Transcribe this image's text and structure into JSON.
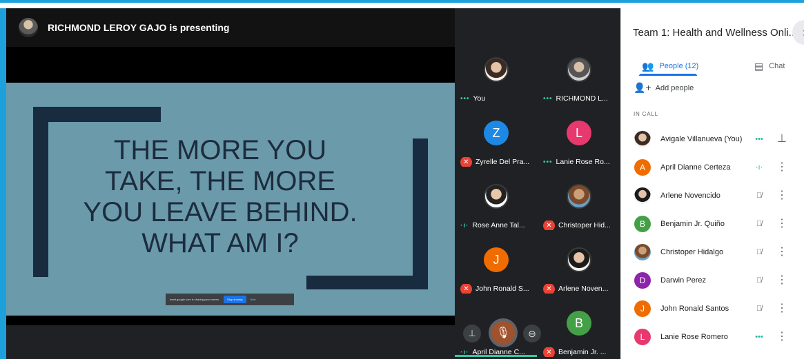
{
  "presenting": {
    "text": "RICHMOND LEROY GAJO is presenting"
  },
  "slide": {
    "lines": [
      "THE MORE YOU",
      "TAKE, THE MORE",
      "YOU LEAVE BEHIND.",
      "WHAT AM I?"
    ]
  },
  "share_bar": {
    "text": "meet.google.com is sharing your screen.",
    "stop_label": "Stop sharing",
    "hide_label": "Hide"
  },
  "tiles": [
    {
      "name": "You",
      "status": "speaking",
      "avatar_letter": "",
      "avatar_color": ""
    },
    {
      "name": "RICHMOND L...",
      "status": "speaking",
      "avatar_letter": "",
      "avatar_color": ""
    },
    {
      "name": "Zyrelle Del Pra...",
      "status": "muted",
      "avatar_letter": "Z",
      "avatar_color": "#1e88e5"
    },
    {
      "name": "Lanie Rose Ro...",
      "status": "speaking",
      "avatar_letter": "L",
      "avatar_color": "#e8396f"
    },
    {
      "name": "Rose Anne Tal...",
      "status": "talking",
      "avatar_letter": "",
      "avatar_color": ""
    },
    {
      "name": "Christoper Hid...",
      "status": "muted",
      "avatar_letter": "",
      "avatar_color": ""
    },
    {
      "name": "John Ronald S...",
      "status": "muted",
      "avatar_letter": "J",
      "avatar_color": "#ef6c00"
    },
    {
      "name": "Arlene Noven...",
      "status": "muted",
      "avatar_letter": "",
      "avatar_color": ""
    },
    {
      "name": "April Dianne C...",
      "status": "talking",
      "avatar_letter": "",
      "avatar_color": ""
    },
    {
      "name": "Benjamin Jr. ...",
      "status": "muted",
      "avatar_letter": "B",
      "avatar_color": "#43a047"
    }
  ],
  "controls": {
    "pin_icon": "pin-icon",
    "mic_icon": "mic-icon",
    "remove_icon": "remove-icon"
  },
  "panel": {
    "title": "Team 1: Health and Wellness Onli...",
    "tab_people": "People (12)",
    "tab_chat": "Chat",
    "add_people": "Add people",
    "in_call_label": "IN CALL",
    "participants": [
      {
        "name": "Avigale Villanueva (You)",
        "status": "speaking",
        "avatar_letter": "",
        "avatar_color": ""
      },
      {
        "name": "April Dianne Certeza",
        "status": "talking",
        "avatar_letter": "A",
        "avatar_color": "#ef6c00"
      },
      {
        "name": "Arlene Novencido",
        "status": "muted",
        "avatar_letter": "",
        "avatar_color": ""
      },
      {
        "name": "Benjamin Jr. Quiño",
        "status": "muted",
        "avatar_letter": "B",
        "avatar_color": "#43a047"
      },
      {
        "name": "Christoper Hidalgo",
        "status": "muted",
        "avatar_letter": "",
        "avatar_color": ""
      },
      {
        "name": "Darwin Perez",
        "status": "muted",
        "avatar_letter": "D",
        "avatar_color": "#8e24aa"
      },
      {
        "name": "John Ronald Santos",
        "status": "muted",
        "avatar_letter": "J",
        "avatar_color": "#ef6c00"
      },
      {
        "name": "Lanie Rose Romero",
        "status": "speaking",
        "avatar_letter": "L",
        "avatar_color": "#e8396f"
      }
    ]
  },
  "colors": {
    "accent": "#1a73e8",
    "frame_blue": "#1da1dc",
    "slide_bg": "#6b9aab",
    "muted_red": "#ea4335",
    "speaking_teal": "#34c8a8"
  }
}
